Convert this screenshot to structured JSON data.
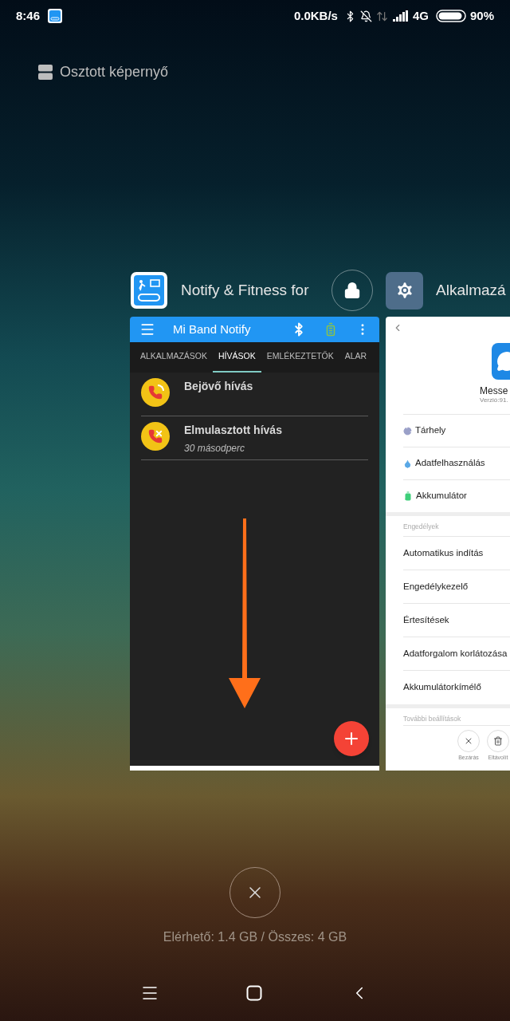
{
  "status_bar": {
    "time": "8:46",
    "net_speed": "0.0KB/s",
    "network": "4G",
    "battery": "90%"
  },
  "split_screen": {
    "label": "Osztott képernyő"
  },
  "recent_apps": [
    {
      "kind": "mi_band",
      "title": "Notify & Fitness for",
      "locked": true,
      "screen": {
        "title": "Mi Band Notify",
        "tabs": [
          {
            "label": "ALKALMAZÁSOK",
            "selected": false
          },
          {
            "label": "HÍVÁSOK",
            "selected": true
          },
          {
            "label": "EMLÉKEZTETŐK",
            "selected": false
          },
          {
            "label": "ALAR",
            "selected": false
          }
        ],
        "items": [
          {
            "kind": "incoming",
            "title": "Bejövő hívás"
          },
          {
            "kind": "missed",
            "title": "Elmulasztott hívás",
            "subtitle": "30 másodperc"
          }
        ]
      }
    },
    {
      "kind": "settings",
      "title": "Alkalmazá",
      "screen": {
        "app_name": "Messe",
        "version": "Verzió:91.",
        "info_rows": [
          {
            "kind": "storage",
            "label": "Tárhely"
          },
          {
            "kind": "data",
            "label": "Adatfelhasználás"
          },
          {
            "kind": "battery",
            "label": "Akkumulátor"
          }
        ],
        "permissions_header": "Engedélyek",
        "permission_rows": [
          "Automatikus indítás",
          "Engedélykezelő",
          "Értesítések",
          "Adatforgalom korlátozása",
          "Akkumulátorkímélő"
        ],
        "more_header": "További beállítások",
        "actions": [
          {
            "kind": "close",
            "label": "Bezárás"
          },
          {
            "kind": "uninstall",
            "label": "Eltávolít"
          }
        ]
      }
    }
  ],
  "memory": "Elérhető: 1.4 GB / Összes: 4 GB"
}
